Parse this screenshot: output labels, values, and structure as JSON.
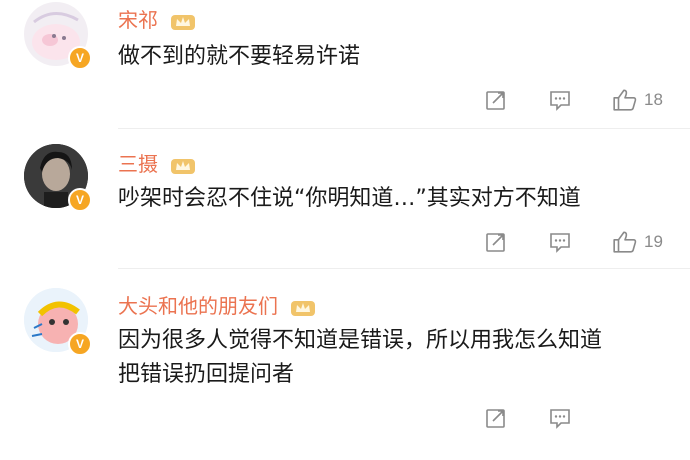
{
  "comments": [
    {
      "username": "宋祁",
      "text_lines": [
        "做不到的就不要轻易许诺"
      ],
      "likes": "18",
      "verified_badge": "V"
    },
    {
      "username": "三摄",
      "text_lines": [
        "吵架时会忍不住说“你明知道…”其实对方不知道"
      ],
      "likes": "19",
      "verified_badge": "V"
    },
    {
      "username": "大头和他的朋友们",
      "text_lines": [
        "因为很多人觉得不知道是错误，所以用我怎么知道",
        "把错误扔回提问者"
      ],
      "likes": "",
      "verified_badge": "V"
    }
  ],
  "icons": {
    "share": "share-icon",
    "comment": "comment-icon",
    "like": "thumbs-up-icon",
    "crown": "crown-badge-icon"
  },
  "colors": {
    "username": "#eb7350",
    "text": "#1a1a1a",
    "icon": "#8a8a8a",
    "verified": "#f6a623"
  }
}
